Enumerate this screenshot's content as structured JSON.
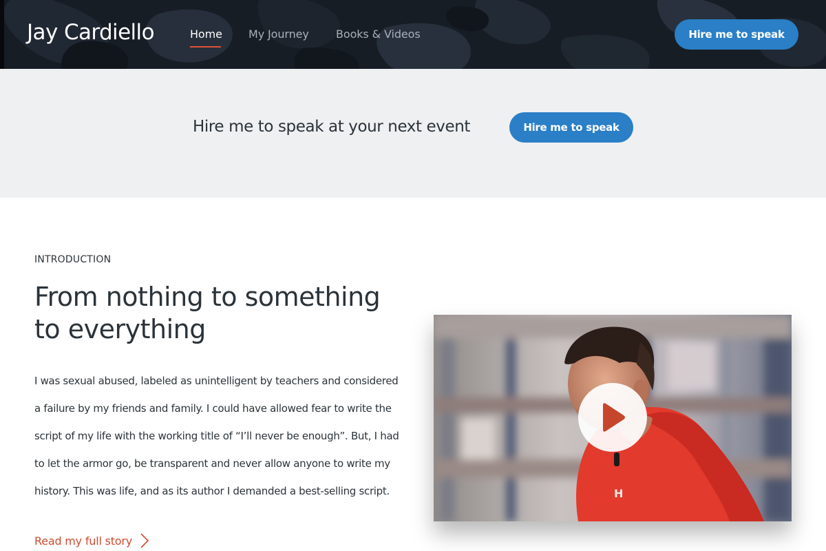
{
  "header": {
    "brand": "Jay Cardiello",
    "nav": [
      {
        "label": "Home",
        "active": true
      },
      {
        "label": "My Journey",
        "active": false
      },
      {
        "label": "Books & Videos",
        "active": false
      }
    ],
    "cta_label": "Hire me to speak"
  },
  "cta_band": {
    "text": "Hire me to speak at your next event",
    "button_label": "Hire me to speak"
  },
  "intro": {
    "eyebrow": "INTRODUCTION",
    "headline_lines": [
      "From nothing to something",
      "to everything"
    ],
    "body_lines": [
      "I was sexual abused, labeled as unintelligent by teachers and considered",
      "a failure by my friends and family. I could have allowed fear to write the",
      "script of my life with the working title of “I’ll never be enough”. But, I had",
      "to let the armor go, be transparent and never allow anyone to write my",
      "history. This was life, and as its author I demanded a best-selling script."
    ],
    "read_more": "Read my full story"
  },
  "video": {
    "icon": "play-icon",
    "shirt_logo_text": "H"
  },
  "colors": {
    "accent_blue": "#2a7fc6",
    "accent_red": "#d04a2f",
    "header_bg": "#171d25",
    "band_bg": "#eef0f2"
  }
}
